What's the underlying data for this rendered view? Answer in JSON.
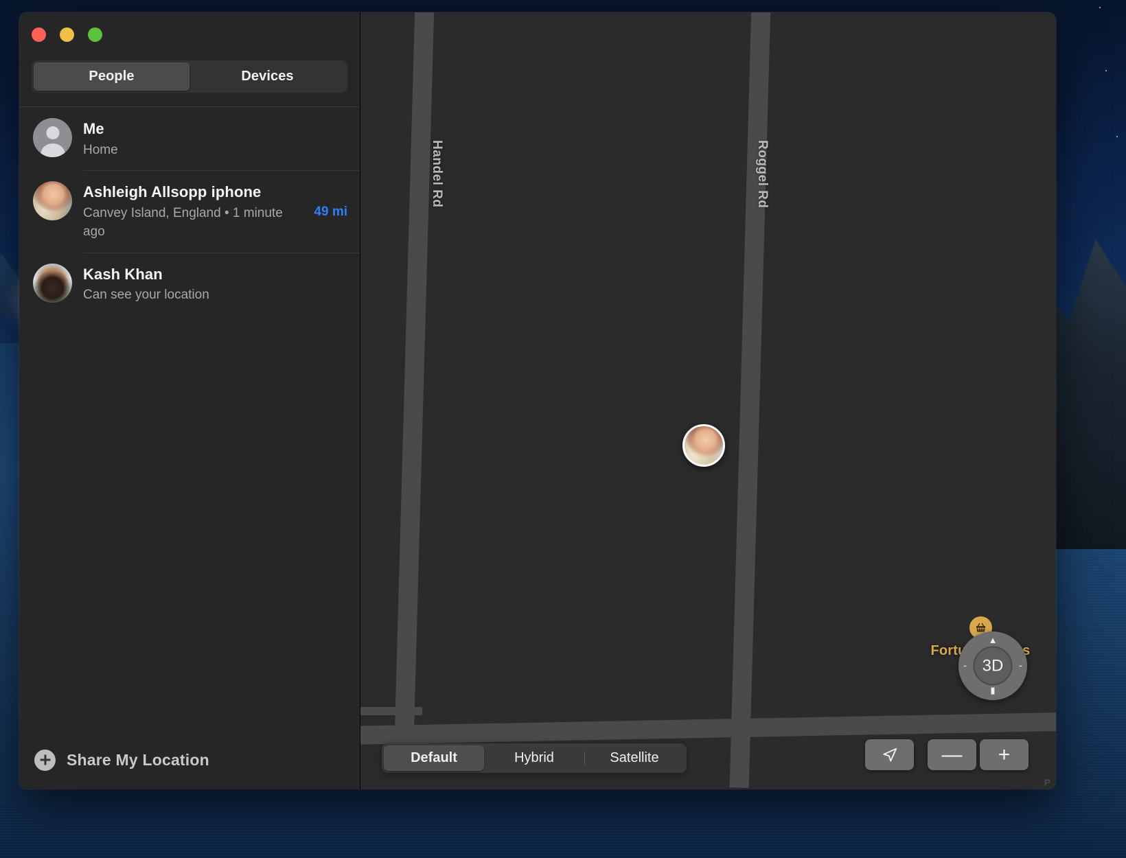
{
  "window": {
    "traffic_lights": [
      "close",
      "minimize",
      "zoom"
    ]
  },
  "sidebar": {
    "tabs": [
      {
        "label": "People",
        "active": true
      },
      {
        "label": "Devices",
        "active": false
      }
    ],
    "people": [
      {
        "name": "Me",
        "subtitle": "Home",
        "distance": "",
        "avatar": "generic-person-icon"
      },
      {
        "name": "Ashleigh Allsopp iphone",
        "subtitle": "Canvey Island, England • 1 minute ago",
        "distance": "49 mi",
        "avatar": "photo-ashleigh"
      },
      {
        "name": "Kash Khan",
        "subtitle": "Can see your location",
        "distance": "",
        "avatar": "photo-kash"
      }
    ],
    "share_button": {
      "label": "Share My Location",
      "icon": "plus-circle-icon"
    }
  },
  "map": {
    "road_labels": [
      "Handel Rd",
      "Roggel Rd"
    ],
    "poi": {
      "name": "Fortuna Stores",
      "icon": "shopping-basket-icon",
      "color": "#d8a94a"
    },
    "pin": {
      "label": "ashleigh-location-pin"
    },
    "map_types": [
      {
        "label": "Default",
        "active": true
      },
      {
        "label": "Hybrid",
        "active": false
      },
      {
        "label": "Satellite",
        "active": false
      }
    ],
    "controls": {
      "dial_label": "3D",
      "dial_up": "▲",
      "dial_down": "▮",
      "dial_left": "-",
      "dial_right": "-",
      "locate_icon": "navigation-arrow-icon",
      "zoom_out": "—",
      "zoom_in": "+"
    },
    "watermark": "P"
  },
  "colors": {
    "accent_blue": "#2d81f7",
    "poi_gold": "#d8a94a",
    "window_bg": "#1e1e1e",
    "sidebar_bg": "#262626",
    "map_bg": "#2b2b2b",
    "road": "#4a4a4a"
  }
}
